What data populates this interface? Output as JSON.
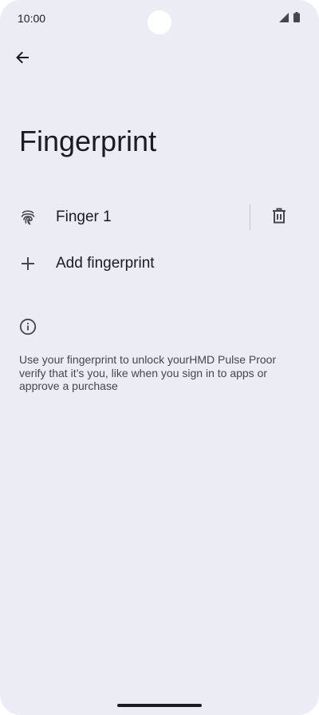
{
  "status_bar": {
    "time": "10:00",
    "icons": [
      "cell-signal-icon",
      "battery-icon"
    ]
  },
  "app_bar": {
    "back_icon": "arrow-back-icon"
  },
  "page": {
    "title": "Fingerprint"
  },
  "fingerprints": [
    {
      "label": "Finger 1",
      "icon": "fingerprint-icon",
      "delete_icon": "trash-icon"
    }
  ],
  "add_fingerprint": {
    "label": "Add fingerprint",
    "icon": "plus-icon"
  },
  "info": {
    "icon": "info-icon",
    "text": "Use your fingerprint to unlock yourHMD Pulse Proor verify that it’s you, like when you sign in to apps or approve a purchase"
  },
  "colors": {
    "background": "#ececf4",
    "text_primary": "#1b1b21",
    "text_secondary": "#45464f",
    "divider": "#c7c6d0"
  }
}
